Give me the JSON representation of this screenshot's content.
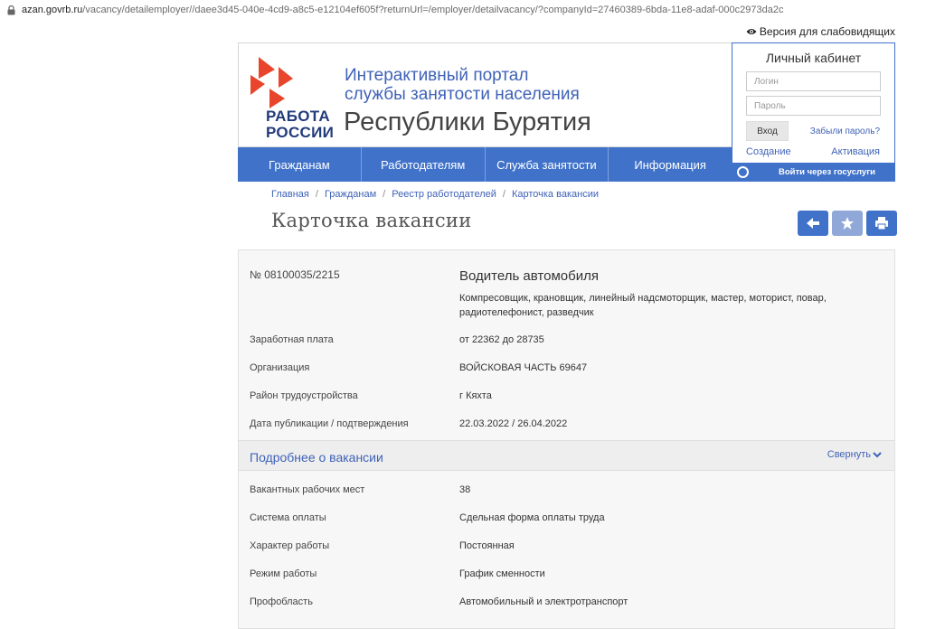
{
  "browser": {
    "url_host": "azan.govrb.ru",
    "url_path": "/vacancy/detailemployer//daee3d45-040e-4cd9-a8c5-e12104ef605f?returnUrl=/employer/detailvacancy/?companyId=27460389-6bda-11e8-adaf-000c2973da2c"
  },
  "accessibility": {
    "label": "Версия для слабовидящих"
  },
  "header": {
    "logo_line1": "РАБОТА",
    "logo_line2": "РОССИИ",
    "portal_line1": "Интерактивный портал",
    "portal_line2": "службы занятости населения",
    "region": "Республики Бурятия"
  },
  "nav": {
    "items": [
      {
        "label": "Гражданам"
      },
      {
        "label": "Работодателям"
      },
      {
        "label": "Служба занятости"
      },
      {
        "label": "Информация"
      }
    ]
  },
  "login": {
    "title": "Личный кабинет",
    "login_placeholder": "Логин",
    "password_placeholder": "Пароль",
    "enter_label": "Вход",
    "forgot_label": "Забыли пароль?",
    "create_label": "Создание",
    "activate_label": "Активация",
    "gosuslugi_label": "Войти через госуслуги"
  },
  "breadcrumb": {
    "items": [
      {
        "label": "Главная"
      },
      {
        "label": "Гражданам"
      },
      {
        "label": "Реестр работодателей"
      },
      {
        "label": "Карточка вакансии"
      }
    ],
    "separator": "/"
  },
  "page": {
    "title": "Карточка вакансии"
  },
  "actions": {
    "back_icon": "arrow-left-icon",
    "favorite_icon": "star-icon",
    "print_icon": "printer-icon"
  },
  "vacancy": {
    "number": "№ 08100035/2215",
    "title": "Водитель автомобиля",
    "description": "Компресовщик, крановщик, линейный надсмоторщик, мастер, моторист, повар, радиотелефонист, разведчик",
    "fields": [
      {
        "label": "Заработная плата",
        "value": "от 22362 до 28735"
      },
      {
        "label": "Организация",
        "value": "ВОЙСКОВАЯ ЧАСТЬ 69647"
      },
      {
        "label": "Район трудоустройства",
        "value": "г Кяхта"
      },
      {
        "label": "Дата публикации / подтверждения",
        "value": "22.03.2022 / 26.04.2022"
      }
    ],
    "more_title": "Подробнее о вакансии",
    "collapse_label": "Свернуть",
    "details": [
      {
        "label": "Вакантных рабочих мест",
        "value": "38"
      },
      {
        "label": "Система оплаты",
        "value": "Сдельная форма оплаты труда"
      },
      {
        "label": "Характер работы",
        "value": "Постоянная"
      },
      {
        "label": "Режим работы",
        "value": "График сменности"
      },
      {
        "label": "Профобласть",
        "value": "Автомобильный и электротранспорт"
      }
    ]
  },
  "colors": {
    "primary": "#4072c9",
    "link": "#3f62b7",
    "logo_red": "#e8452c",
    "logo_blue": "#223b7a"
  }
}
